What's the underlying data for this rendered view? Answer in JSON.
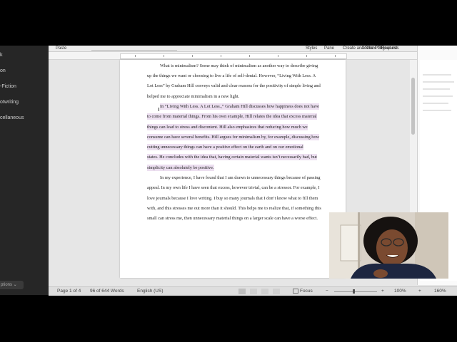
{
  "sidebar": {
    "items": [
      "k",
      "on",
      "-Fiction",
      "otwriting",
      "cellaneous"
    ],
    "options_button": "ptions"
  },
  "ribbon": {
    "labels": [
      "Paste",
      "Styles",
      "Pane",
      "Create and Share",
      "Adobe PDF",
      "Request",
      "Signatures"
    ]
  },
  "document": {
    "p1": [
      "What is minimalism? Some may think of minimalism as another way to describe giving",
      "up the things we want or choosing to live a life of self-denial. However, “Living With Less. A",
      "Lot Less” by Graham Hill conveys valid and clear reasons for the positivity of simple living and",
      "helped me to appreciate minimalism in a new light."
    ],
    "p2": [
      "In “Living With Less. A Lot Less.,” Graham Hill discusses how happiness does not have",
      "to come from material things. From his own example, Hill relates the idea that excess material",
      "things can lead to stress and discontent. Hill also emphasizes that reducing how much we",
      "consume can have several benefits. Hill argues for minimalism by, for example, discussing how",
      "cutting unnecessary things can have a positive effect on the earth and on our emotional",
      "states. He concludes with the idea that, having certain material wants isn’t necessarily bad, but",
      "simplicity can absolutely be positive."
    ],
    "p3": [
      "In my experience, I have found that I am drawn to unnecessary things because of passing",
      "appeal. In my own life I have seen that excess, however trivial, can be a stressor. For example, I",
      "love journals because I love writing. I buy so many journals that I don’t know what to fill them",
      "with, and this stresses me out more than it should. This helps me to realize that, if something this",
      "small can stress me, then unnecessary material things on a larger scale can have a worse effect."
    ]
  },
  "status": {
    "page": "Page 1 of 4",
    "words": "96 of 644 Words",
    "language": "English (US)",
    "focus": "Focus",
    "zoom": "100%",
    "zoom_right": "160%"
  }
}
